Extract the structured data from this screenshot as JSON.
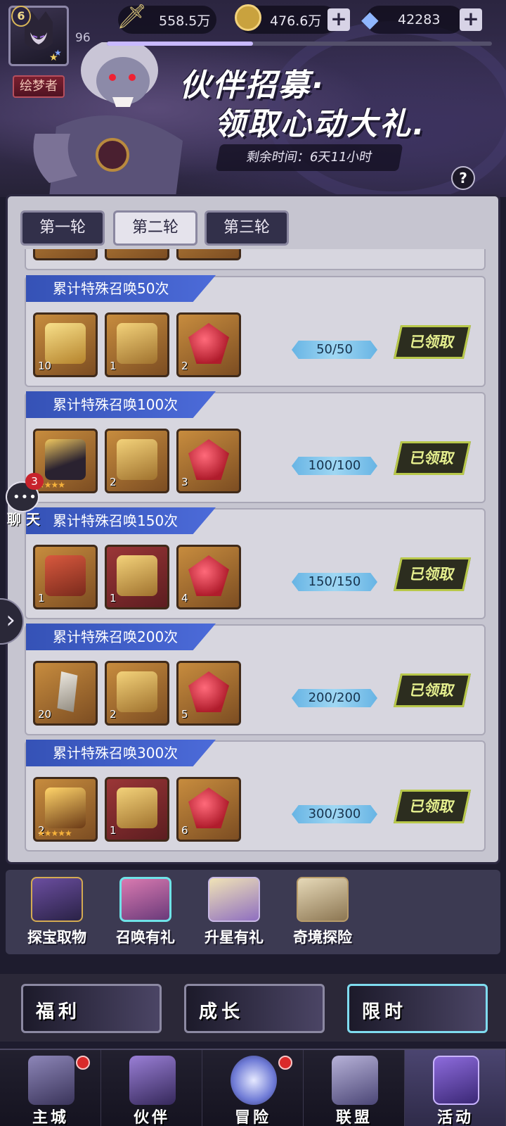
{
  "player": {
    "level": "6",
    "exp_level": "96",
    "title": "绘梦者",
    "exp_progress": 0.38
  },
  "resources": {
    "power": "558.5万",
    "gold": "476.6万",
    "diamonds": "42283"
  },
  "banner": {
    "line1": "伙伴招募·",
    "line2": "领取心动大礼.",
    "timer": "剩余时间：6天11小时"
  },
  "tabs": [
    {
      "label": "第一轮"
    },
    {
      "label": "第二轮"
    },
    {
      "label": "第三轮"
    }
  ],
  "active_tab": 1,
  "rows": [
    {
      "title": "累计特殊召唤50次",
      "items": [
        {
          "count": "10",
          "type": "scroll"
        },
        {
          "count": "1",
          "type": "gift"
        },
        {
          "count": "2",
          "type": "gem"
        }
      ],
      "progress": "50/50",
      "status": "已领取"
    },
    {
      "title": "累计特殊召唤100次",
      "items": [
        {
          "count": "",
          "type": "hero",
          "stars": "★★★★"
        },
        {
          "count": "2",
          "type": "gift"
        },
        {
          "count": "3",
          "type": "gem"
        }
      ],
      "progress": "100/100",
      "status": "已领取"
    },
    {
      "title": "累计特殊召唤150次",
      "items": [
        {
          "count": "1",
          "type": "equip"
        },
        {
          "count": "1",
          "type": "gift-red"
        },
        {
          "count": "4",
          "type": "gem"
        }
      ],
      "progress": "150/150",
      "status": "已领取"
    },
    {
      "title": "累计特殊召唤200次",
      "items": [
        {
          "count": "20",
          "type": "crystal"
        },
        {
          "count": "2",
          "type": "gift"
        },
        {
          "count": "5",
          "type": "gem"
        }
      ],
      "progress": "200/200",
      "status": "已领取"
    },
    {
      "title": "累计特殊召唤300次",
      "items": [
        {
          "count": "2",
          "type": "hero-gold",
          "stars": "★★★★★"
        },
        {
          "count": "1",
          "type": "gift-red"
        },
        {
          "count": "6",
          "type": "gem"
        }
      ],
      "progress": "300/300",
      "status": "已领取"
    }
  ],
  "chat": {
    "label": "聊 天",
    "badge": "3"
  },
  "activities": [
    {
      "label": "探宝取物"
    },
    {
      "label": "召唤有礼"
    },
    {
      "label": "升星有礼"
    },
    {
      "label": "奇境探险"
    }
  ],
  "categories": [
    {
      "label": "福利"
    },
    {
      "label": "成长"
    },
    {
      "label": "限时"
    }
  ],
  "nav": [
    {
      "label": "主城"
    },
    {
      "label": "伙伴"
    },
    {
      "label": "冒险"
    },
    {
      "label": "联盟"
    },
    {
      "label": "活动"
    }
  ],
  "colors": {
    "accent_blue": "#3552b6",
    "claimed_green": "#b8c84a",
    "badge_red": "#c8232c"
  }
}
